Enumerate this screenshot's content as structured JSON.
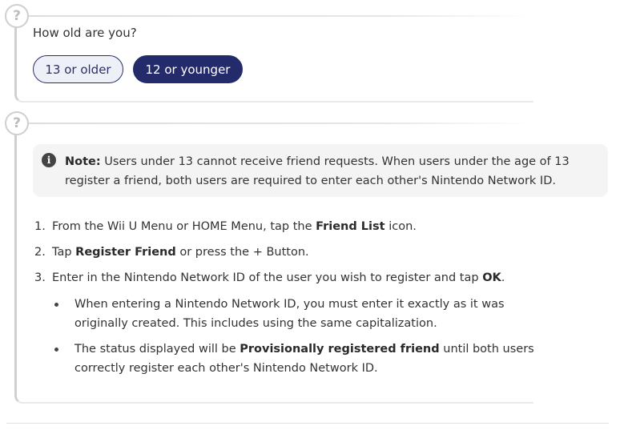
{
  "question1": {
    "badge": "?",
    "text": "How old are you?",
    "options": [
      "13 or older",
      "12 or younger"
    ],
    "selected": "12 or younger"
  },
  "question2": {
    "badge": "?",
    "note": {
      "label": "Note:",
      "line1": " Users under 13 cannot receive friend requests. When users under the age of 13",
      "line2": "register a friend, both users are required to enter each other's Nintendo Network ID."
    },
    "steps": [
      {
        "num": "1.",
        "pre": "From the Wii U Menu or HOME Menu, tap the ",
        "bold": "Friend List",
        "post": " icon."
      },
      {
        "num": "2.",
        "pre": "Tap ",
        "bold": "Register Friend",
        "post": " or press the + Button."
      },
      {
        "num": "3.",
        "pre": "Enter in the Nintendo Network ID of the user you wish to register and tap ",
        "bold": "OK",
        "post": "."
      }
    ],
    "bullets": [
      {
        "line1": "When entering a Nintendo Network ID, you must enter it exactly as it was",
        "line2": "originally created. This includes using the same capitalization."
      },
      {
        "line1_pre": "The status displayed will be ",
        "line1_bold": "Provisionally registered friend",
        "line1_post": " until both users",
        "line2": "correctly register each other's Nintendo Network ID."
      }
    ]
  },
  "colors": {
    "selected_button": "#232b6b",
    "unselected_button_bg": "#eef0f8",
    "note_bg": "#f4f4f4",
    "card_border": "#cfcfcf"
  }
}
